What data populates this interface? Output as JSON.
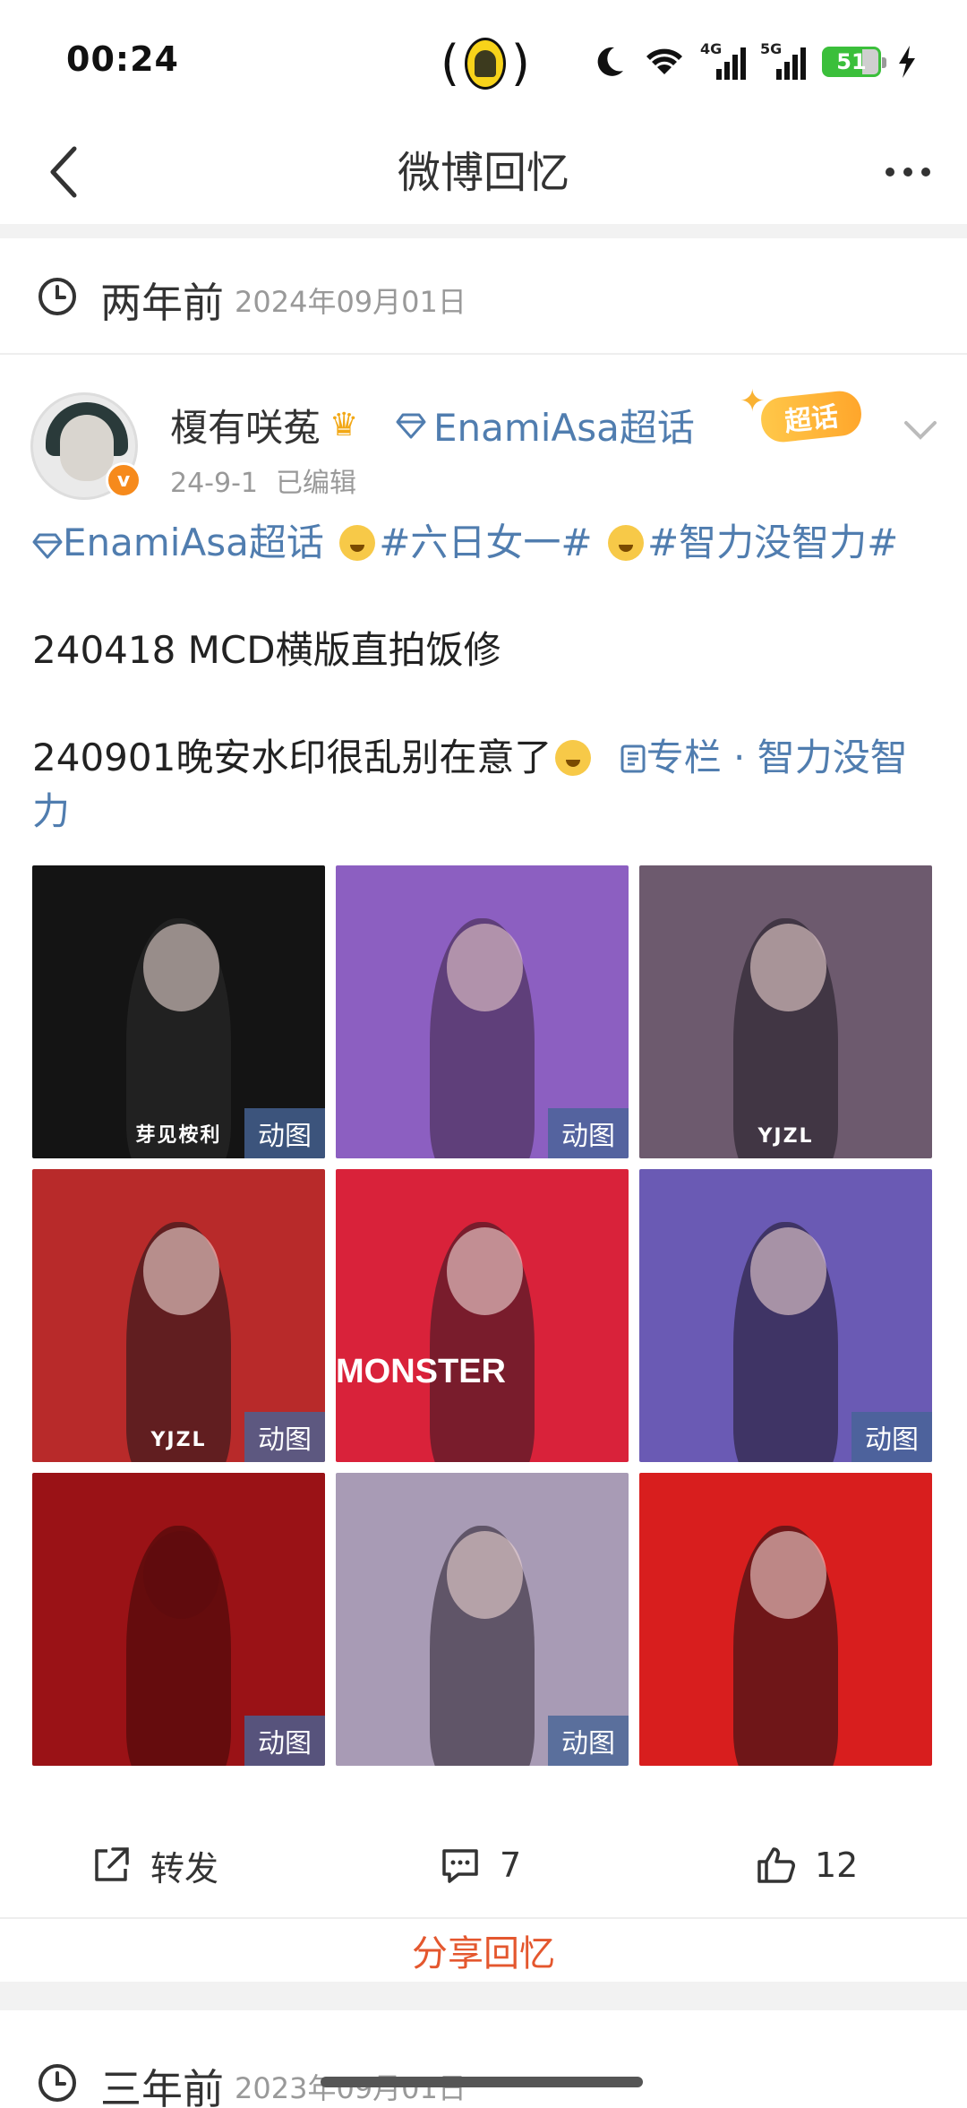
{
  "status_bar": {
    "time": "00:24",
    "net1_label": "4G",
    "net2_label": "5G",
    "battery_level": "51"
  },
  "nav": {
    "title": "微博回忆"
  },
  "memory": {
    "ago": "两年前",
    "date": "2024年09月01日"
  },
  "post": {
    "author": "榎有咲菟",
    "topic_link": "EnamiAsa超话",
    "super_badge": "超话",
    "time": "24-9-1",
    "edited": "已编辑",
    "line1_topic": "EnamiAsa超话",
    "line1_tag1": "#六日女一#",
    "line1_tag2": "#智力没智力#",
    "line2": "240418 MCD横版直拍饭修",
    "line3_text": "240901晚安水印很乱别在意了",
    "line3_link": "专栏 · 智力没智力"
  },
  "images": [
    {
      "bg": "#141414",
      "fig": "#2b2b2b",
      "head": "#e8d6d0",
      "gif": "动图",
      "watermark": "芽见桉利",
      "overlay": ""
    },
    {
      "bg": "#8c5fc1",
      "fig": "#3a2440",
      "head": "#e7c9cc",
      "gif": "动图",
      "watermark": "",
      "overlay": ""
    },
    {
      "bg": "#6d5a6e",
      "fig": "#1e1a22",
      "head": "#edd4d0",
      "gif": "",
      "watermark": "YJZL",
      "overlay": ""
    },
    {
      "bg": "#b82a2a",
      "fig": "#1a1418",
      "head": "#f0d8d6",
      "gif": "动图",
      "watermark": "YJZL",
      "overlay": ""
    },
    {
      "bg": "#d9223a",
      "fig": "#2a1820",
      "head": "#f4dbd8",
      "gif": "",
      "watermark": "",
      "overlay": "MONSTER"
    },
    {
      "bg": "#6a5ab4",
      "fig": "#1c1624",
      "head": "#ecd2d2",
      "gif": "动图",
      "watermark": "",
      "overlay": ""
    },
    {
      "bg": "#9a1216",
      "fig": "#3a0708",
      "head": "#5e0b0d",
      "gif": "动图",
      "watermark": "",
      "overlay": ""
    },
    {
      "bg": "#a89bb5",
      "fig": "#241c28",
      "head": "#efd6d4",
      "gif": "动图",
      "watermark": "",
      "overlay": ""
    },
    {
      "bg": "#d81e1e",
      "fig": "#1a1014",
      "head": "#f2d4d0",
      "gif": "",
      "watermark": "",
      "overlay": ""
    }
  ],
  "actions": {
    "forward_label": "转发",
    "comments": "7",
    "likes": "12"
  },
  "share_label": "分享回忆",
  "next_memory": {
    "ago": "三年前",
    "date": "2023年09月01日"
  },
  "colors": {
    "link": "#507daf",
    "share": "#e4572e",
    "verified": "#f68a1c"
  }
}
